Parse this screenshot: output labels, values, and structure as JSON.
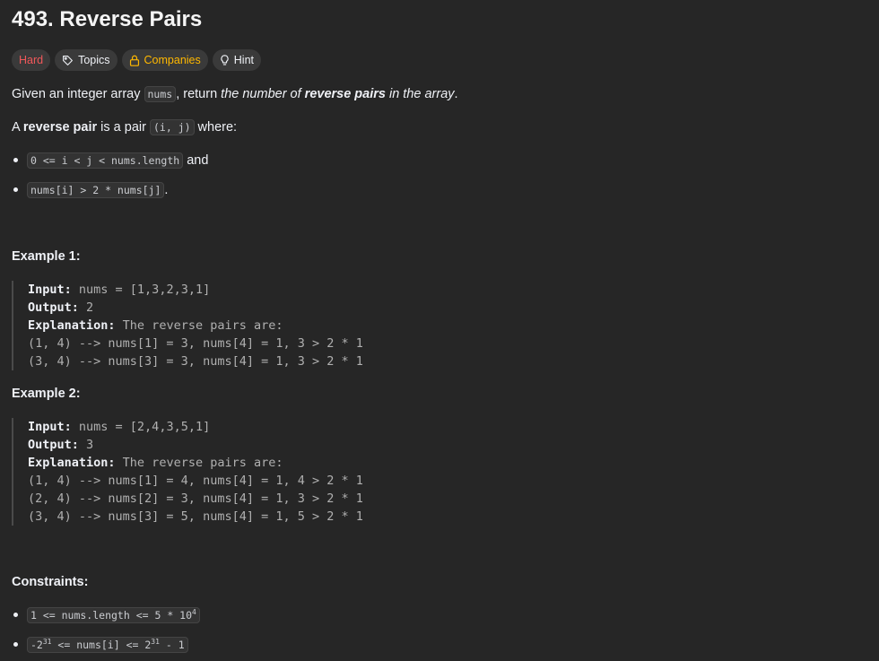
{
  "problem": {
    "title": "493. Reverse Pairs"
  },
  "tags": {
    "difficulty": "Hard",
    "topics": "Topics",
    "companies": "Companies",
    "hint": "Hint"
  },
  "description": {
    "p1_before": "Given an integer array ",
    "p1_code": "nums",
    "p1_middle": ", return ",
    "p1_em1": "the number of ",
    "p1_strong": "reverse pairs",
    "p1_em2": " in the array",
    "p1_end": ".",
    "p2_before": "A ",
    "p2_strong": "reverse pair",
    "p2_middle": " is a pair ",
    "p2_code": "(i, j)",
    "p2_end": " where:",
    "bullet1_code": "0 <= i < j < nums.length",
    "bullet1_end": " and",
    "bullet2_code": "nums[i] > 2 * nums[j]",
    "bullet2_end": "."
  },
  "examples": [
    {
      "heading": "Example 1:",
      "input_label": "Input:",
      "input_value": " nums = [1,3,2,3,1]",
      "output_label": "Output:",
      "output_value": " 2",
      "explanation_label": "Explanation:",
      "explanation_value": " The reverse pairs are:",
      "lines": [
        "(1, 4) --> nums[1] = 3, nums[4] = 1, 3 > 2 * 1",
        "(3, 4) --> nums[3] = 3, nums[4] = 1, 3 > 2 * 1"
      ]
    },
    {
      "heading": "Example 2:",
      "input_label": "Input:",
      "input_value": " nums = [2,4,3,5,1]",
      "output_label": "Output:",
      "output_value": " 3",
      "explanation_label": "Explanation:",
      "explanation_value": " The reverse pairs are:",
      "lines": [
        "(1, 4) --> nums[1] = 4, nums[4] = 1, 4 > 2 * 1",
        "(2, 4) --> nums[2] = 3, nums[4] = 1, 3 > 2 * 1",
        "(3, 4) --> nums[3] = 5, nums[4] = 1, 5 > 2 * 1"
      ]
    }
  ],
  "constraints": {
    "heading": "Constraints:",
    "c1_prefix": "1 <= nums.length <= 5 * 10",
    "c1_sup": "4",
    "c2_a": "-2",
    "c2_sup1": "31",
    "c2_b": " <= nums[i] <= 2",
    "c2_sup2": "31",
    "c2_c": " - 1"
  },
  "colors": {
    "background": "#262626",
    "hard": "#f1585a",
    "companies": "#ffb800",
    "tag_bg": "#3a3a3a"
  },
  "icons": {
    "topics": "tag-icon",
    "companies": "lock-icon",
    "hint": "lightbulb-icon"
  }
}
